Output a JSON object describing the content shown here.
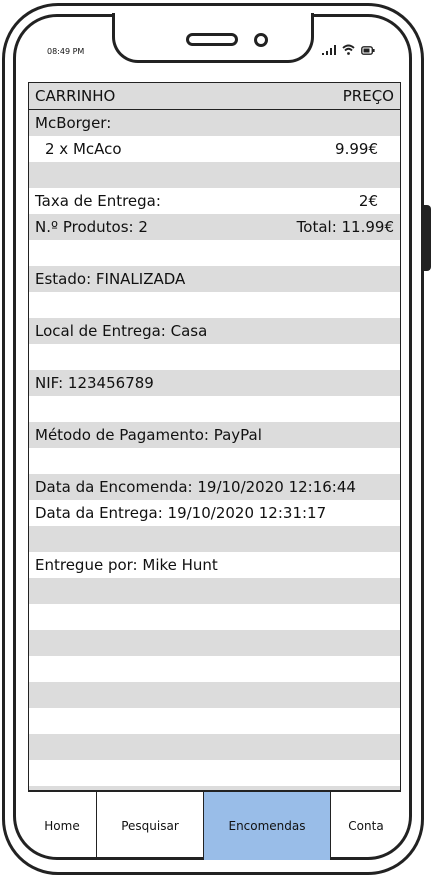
{
  "status": {
    "time": "08:49 PM"
  },
  "cart": {
    "col_item": "CARRINHO",
    "col_price": "PREÇO",
    "restaurant": "McBorger:",
    "item_line": "2 x McAco",
    "item_price": "9.99€",
    "fee_label": "Taxa de Entrega:",
    "fee_value": "2€",
    "products": "N.º Produtos: 2",
    "total": "Total: 11.99€",
    "estado": "Estado: FINALIZADA",
    "local": "Local de Entrega: Casa",
    "nif": "NIF: 123456789",
    "pagamento": "Método de Pagamento: PayPal",
    "data_encomenda": "Data da Encomenda: 19/10/2020 12:16:44",
    "data_entrega": "Data da Entrega: 19/10/2020 12:31:17",
    "entregue": "Entregue por: Mike Hunt"
  },
  "tabs": {
    "home": "Home",
    "pesquisar": "Pesquisar",
    "encomendas": "Encomendas",
    "conta": "Conta",
    "active_color": "#99bde8"
  },
  "icons": [
    "signal-icon",
    "wifi-icon",
    "battery-icon"
  ]
}
